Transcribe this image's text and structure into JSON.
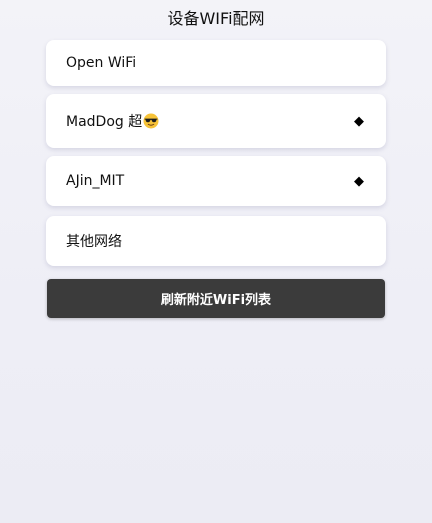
{
  "page": {
    "title": "设备WIFi配网"
  },
  "networks": [
    {
      "name": "Open WiFi",
      "locked": false
    },
    {
      "name": "MadDog 超",
      "emoji": "sunglasses-emoji",
      "locked": true,
      "lock_glyph": "◆"
    },
    {
      "name": "AJin_MIT",
      "locked": true,
      "lock_glyph": "◆"
    },
    {
      "name": "其他网络",
      "locked": false
    }
  ],
  "actions": {
    "refresh_label": "刷新附近WiFi列表"
  },
  "colors": {
    "background": "#efeff6",
    "card": "#ffffff",
    "button": "#3b3b3b",
    "button_text": "#ffffff"
  }
}
